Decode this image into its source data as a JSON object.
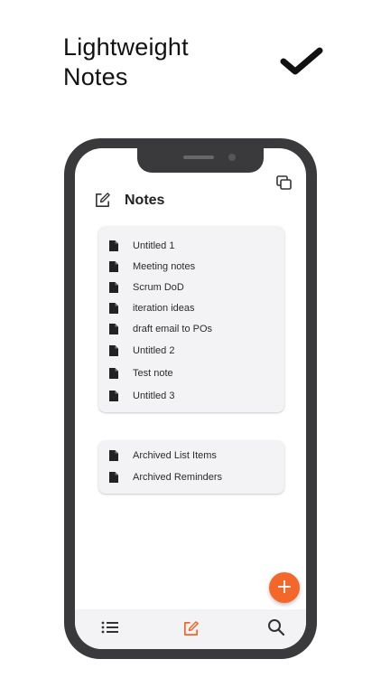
{
  "promo": {
    "headline_line1": "Lightweight",
    "headline_line2": "Notes",
    "check_icon": "checkmark-icon"
  },
  "header": {
    "title": "Notes",
    "left_icon": "edit-note-icon",
    "right_icon": "copy-icon"
  },
  "notes": {
    "items": [
      {
        "label": "Untitled 1"
      },
      {
        "label": "Meeting notes"
      },
      {
        "label": "Scrum DoD"
      },
      {
        "label": "iteration ideas"
      },
      {
        "label": "draft email to POs"
      },
      {
        "label": "Untitled 2"
      },
      {
        "label": "Test note"
      },
      {
        "label": "Untitled 3"
      }
    ]
  },
  "archive": {
    "items": [
      {
        "label": "Archived List Items"
      },
      {
        "label": "Archived Reminders"
      }
    ]
  },
  "fab": {
    "icon": "plus-icon",
    "symbol": "+"
  },
  "bottom_nav": {
    "items": [
      {
        "icon": "list-icon"
      },
      {
        "icon": "edit-note-icon",
        "active": true
      },
      {
        "icon": "search-icon"
      }
    ]
  },
  "colors": {
    "accent": "#f4672a",
    "phone_frame": "#3a3a3d",
    "card_bg": "#f3f3f5",
    "text": "#2b2b2b"
  }
}
